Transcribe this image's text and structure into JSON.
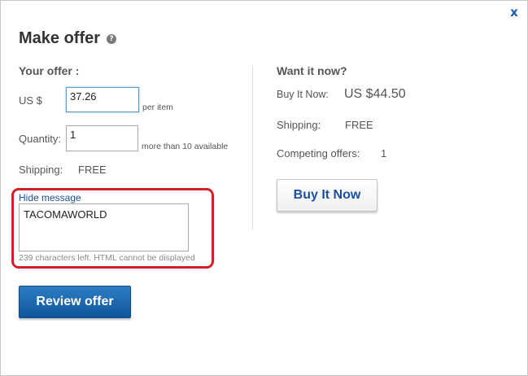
{
  "dialog": {
    "title": "Make offer",
    "help_icon": "?",
    "close_icon": "x"
  },
  "your_offer": {
    "heading": "Your offer :",
    "currency_label": "US $",
    "price_value": "37.26",
    "per_item": "per item",
    "quantity_label": "Quantity:",
    "quantity_value": "1",
    "available": "more than 10 available",
    "shipping_label": "Shipping:",
    "shipping_value": "FREE",
    "hide_message": "Hide message",
    "message_text": "TACOMAWORLD",
    "chars_left": "239 characters left. HTML cannot be displayed",
    "review_button": "Review offer"
  },
  "want_it_now": {
    "heading": "Want it now?",
    "buy_it_now_label": "Buy It Now:",
    "buy_it_now_price": "US $44.50",
    "shipping_label": "Shipping:",
    "shipping_value": "FREE",
    "competing_label": "Competing offers:",
    "competing_value": "1",
    "buy_button": "Buy It Now"
  },
  "colors": {
    "primary_button": "#0f5599",
    "link": "#1a4f9c",
    "highlight_border": "#d0202a"
  }
}
